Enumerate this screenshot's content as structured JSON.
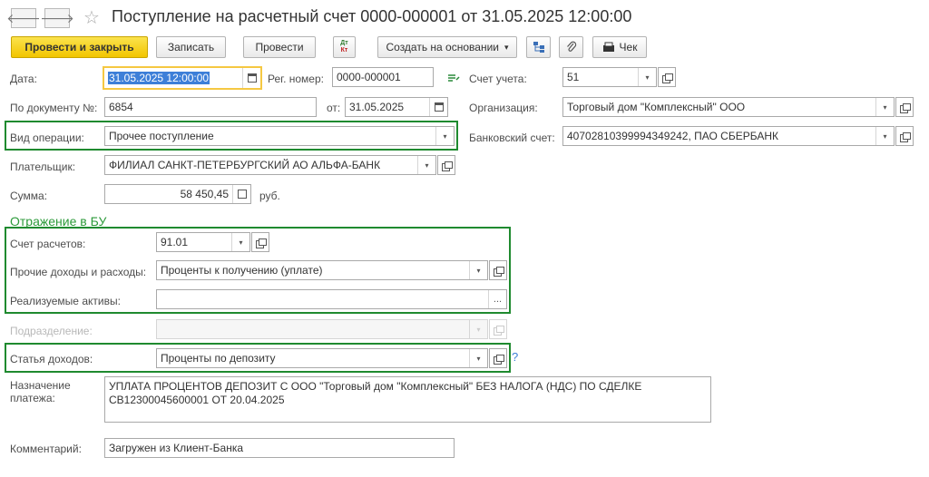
{
  "window": {
    "title": "Поступление на расчетный счет 0000-000001 от 31.05.2025 12:00:00",
    "back_glyph": "🡐",
    "forward_glyph": "🡒",
    "favorite_glyph": "☆"
  },
  "toolbar": {
    "post_close": "Провести и закрыть",
    "save": "Записать",
    "post": "Провести",
    "dt": "Дт",
    "kt": "Кт",
    "create_based": "Создать на основании",
    "create_based_arrow": "▾",
    "check": "Чек"
  },
  "fields": {
    "date": {
      "label": "Дата:",
      "value": "31.05.2025 12:00:00"
    },
    "reg_number": {
      "label": "Рег. номер:",
      "value": "0000-000001"
    },
    "account": {
      "label": "Счет учета:",
      "value": "51"
    },
    "doc_number": {
      "label": "По документу №:",
      "value": "6854"
    },
    "doc_date": {
      "label": "от:",
      "value": "31.05.2025"
    },
    "organization": {
      "label": "Организация:",
      "value": "Торговый дом \"Комплексный\" ООО"
    },
    "operation": {
      "label": "Вид операции:",
      "value": "Прочее поступление"
    },
    "bank_account": {
      "label": "Банковский счет:",
      "value": "40702810399994349242, ПАО СБЕРБАНК"
    },
    "payer": {
      "label": "Плательщик:",
      "value": "ФИЛИАЛ САНКТ-ПЕТЕРБУРГСКИЙ АО АЛЬФА-БАНК"
    },
    "amount": {
      "label": "Сумма:",
      "value": "58 450,45",
      "currency": "руб."
    }
  },
  "section_bu": {
    "title": "Отражение в БУ",
    "settlement_account": {
      "label": "Счет расчетов:",
      "value": "91.01"
    },
    "other_income": {
      "label": "Прочие доходы и расходы:",
      "value": "Проценты к получению (уплате)"
    },
    "assets": {
      "label": "Реализуемые активы:",
      "value": "",
      "select_glyph": "..."
    },
    "department": {
      "label": "Подразделение:",
      "value": ""
    },
    "income_item": {
      "label": "Статья доходов:",
      "value": "Проценты по депозиту",
      "help": "?"
    }
  },
  "purpose": {
    "label_line1": "Назначение",
    "label_line2": "платежа:",
    "value": "УПЛАТА ПРОЦЕНТОВ ДЕПОЗИТ С ООО \"Торговый дом \"Комплексный\" БЕЗ НАЛОГА (НДС) ПО СДЕЛКЕ СВ12300045600001 ОТ 20.04.2025"
  },
  "comment": {
    "label": "Комментарий:",
    "value": "Загружен из Клиент-Банка"
  },
  "icons": {
    "dropdown": "▾",
    "calendar": "calendar-icon",
    "open": "open-icon"
  },
  "colors": {
    "highlight_green": "#1f8a2f",
    "section_green": "#2c9a3a",
    "primary_button": "#f2c500",
    "date_focus": "#f5c842"
  }
}
